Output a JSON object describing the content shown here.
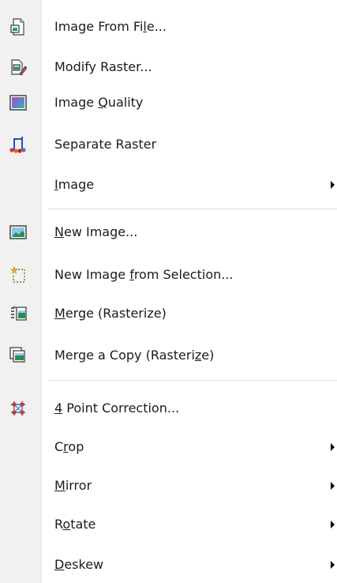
{
  "menu": {
    "items": [
      {
        "pre": "Image From Fi",
        "u": "l",
        "post": "e...",
        "icon": "image-from-file-icon",
        "submenu": false
      },
      {
        "pre": "Modify Raster...",
        "u": "",
        "post": "",
        "icon": "modify-raster-icon",
        "submenu": false
      },
      {
        "pre": "Image ",
        "u": "Q",
        "post": "uality",
        "icon": "image-quality-icon",
        "submenu": false
      },
      {
        "pre": "Separate Raster",
        "u": "",
        "post": "",
        "icon": "separate-raster-icon",
        "submenu": false
      },
      {
        "pre": "",
        "u": "I",
        "post": "mage",
        "icon": "",
        "submenu": true
      },
      {
        "pre": "",
        "u": "N",
        "post": "ew Image...",
        "icon": "new-image-icon",
        "submenu": false
      },
      {
        "pre": "New Image ",
        "u": "f",
        "post": "rom Selection...",
        "icon": "new-image-from-selection-icon",
        "submenu": false
      },
      {
        "pre": "",
        "u": "M",
        "post": "erge (Rasterize)",
        "icon": "merge-rasterize-icon",
        "submenu": false
      },
      {
        "pre": "Merge a Copy (Rasteri",
        "u": "z",
        "post": "e)",
        "icon": "merge-copy-icon",
        "submenu": false
      },
      {
        "pre": "",
        "u": "4",
        "post": " Point Correction...",
        "icon": "four-point-correction-icon",
        "submenu": false
      },
      {
        "pre": "C",
        "u": "r",
        "post": "op",
        "icon": "",
        "submenu": true
      },
      {
        "pre": "",
        "u": "M",
        "post": "irror",
        "icon": "",
        "submenu": true
      },
      {
        "pre": "R",
        "u": "o",
        "post": "tate",
        "icon": "",
        "submenu": true
      },
      {
        "pre": "",
        "u": "D",
        "post": "eskew",
        "icon": "",
        "submenu": true
      }
    ]
  }
}
